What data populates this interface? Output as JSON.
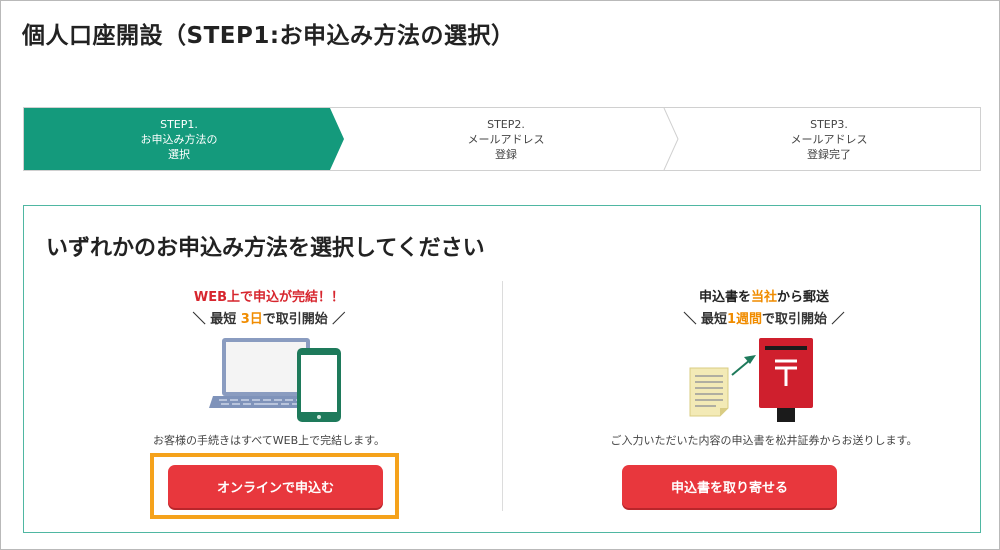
{
  "page": {
    "title": "個人口座開設（STEP1:お申込み方法の選択）"
  },
  "steps": [
    {
      "num": "STEP1.",
      "lines": [
        "お申込み方法の",
        "選択"
      ],
      "active": true
    },
    {
      "num": "STEP2.",
      "lines": [
        "メールアドレス",
        "登録"
      ],
      "active": false
    },
    {
      "num": "STEP3.",
      "lines": [
        "メールアドレス",
        "登録完了"
      ],
      "active": false
    }
  ],
  "panel": {
    "heading": "いずれかのお申込み方法を選択してください",
    "online": {
      "catch1": "WEB上で申込が完結！！",
      "catch2_pre": "＼ 最短 ",
      "catch2_em": "3日",
      "catch2_post": "で取引開始 ／",
      "desc": "お客様の手続きはすべてWEB上で完結します。",
      "button": "オンラインで申込む"
    },
    "mail": {
      "catch1_a": "申込書を",
      "catch1_em": "当社",
      "catch1_b": "から郵送",
      "catch2_pre": "＼ 最短",
      "catch2_em": "1週間",
      "catch2_post": "で取引開始 ／",
      "desc": "ご入力いただいた内容の申込書を松井証券からお送りします。",
      "button": "申込書を取り寄せる"
    }
  },
  "colors": {
    "step_active": "#149a7c",
    "panel_border": "#4fb7a2",
    "cta": "#e8373d",
    "highlight": "#f5a21b",
    "accent_red": "#d7262e",
    "accent_orange": "#f08c00"
  }
}
